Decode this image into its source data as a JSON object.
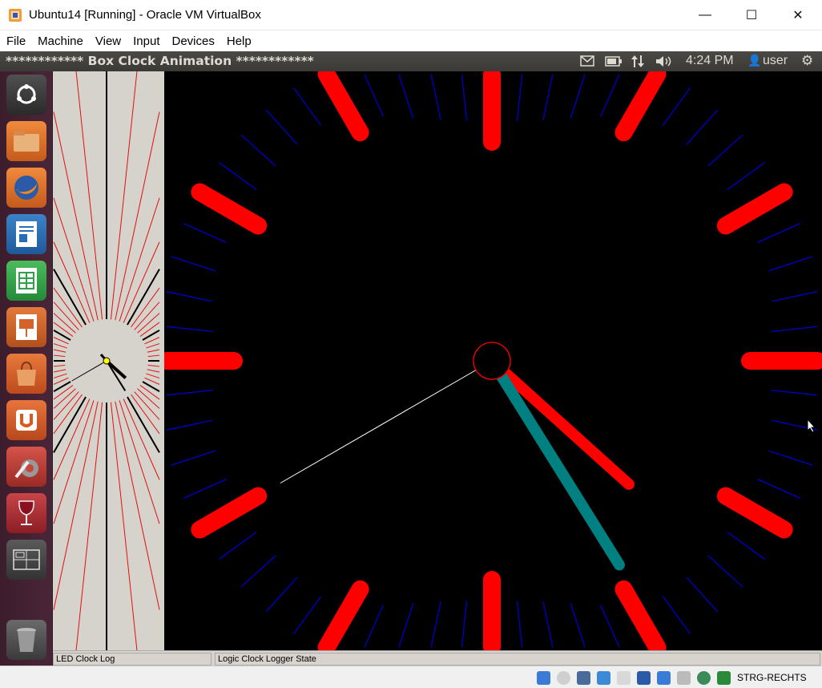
{
  "window": {
    "title": "Ubuntu14 [Running] - Oracle VM VirtualBox",
    "minimize_glyph": "—",
    "maximize_glyph": "☐",
    "close_glyph": "✕"
  },
  "vbox_menu": [
    "File",
    "Machine",
    "View",
    "Input",
    "Devices",
    "Help"
  ],
  "unity_panel": {
    "window_title": "************ Box Clock Animation ************",
    "indicators": {
      "mail_icon": "mail-icon",
      "battery_icon": "battery-icon",
      "network_icon": "network-arrows-icon",
      "sound_icon": "speaker-icon",
      "time": "4:24 PM",
      "user_glyph": "👤",
      "user": "user",
      "settings_glyph": "⚙"
    }
  },
  "launcher": [
    {
      "name": "ubuntu-dash-icon",
      "color": "#2b2b2b"
    },
    {
      "name": "files-icon",
      "color": "#e8742f"
    },
    {
      "name": "firefox-icon",
      "color": "#e46c1f"
    },
    {
      "name": "writer-icon",
      "color": "#2a6db7"
    },
    {
      "name": "calc-icon",
      "color": "#30a14a"
    },
    {
      "name": "impress-icon",
      "color": "#d4622a"
    },
    {
      "name": "software-center-icon",
      "color": "#e0622a"
    },
    {
      "name": "ubuntu-one-icon",
      "color": "#dd5a1f"
    },
    {
      "name": "system-settings-icon",
      "color": "#c9443a"
    },
    {
      "name": "wine-icon",
      "color": "#b13034"
    },
    {
      "name": "workspace-switcher-icon",
      "color": "#4a4a4a"
    },
    {
      "name": "trash-icon",
      "color": "#5a5a5a"
    }
  ],
  "clock": {
    "time": "4:24",
    "seconds": 40,
    "colors": {
      "hour_marker": "#ff0000",
      "minute_tick": "#0000cc",
      "hour_hand": "#ff0000",
      "minute_hand": "#008080",
      "second_hand": "#ffffff",
      "center_ring": "#ff0000"
    }
  },
  "statusbar": {
    "led_log": "LED Clock Log",
    "logic_log": "Logic Clock Logger State"
  },
  "vbox_status": {
    "icons": [
      "hard-disk-icon",
      "optical-drive-icon",
      "audio-icon",
      "usb-icon",
      "shared-folder-icon",
      "display-icon",
      "network-icon",
      "cpu-icon",
      "globe-icon",
      "host-key-arrow-icon"
    ],
    "host_key": "STRG-RECHTS"
  }
}
